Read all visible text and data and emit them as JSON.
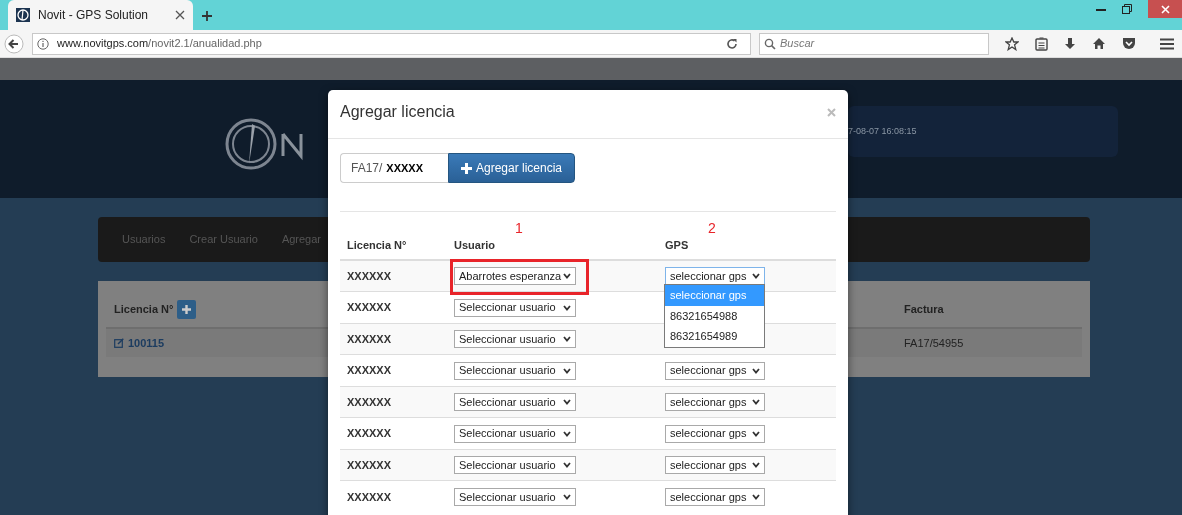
{
  "browser": {
    "tab_title": "Novit - GPS Solution",
    "url_host": "www.novitgps.com",
    "url_path": "/novit2.1/anualidad.php",
    "search_placeholder": "Buscar"
  },
  "background": {
    "datetime": "7-08-07 16:08:15",
    "nav_items": [
      "Usuarios",
      "Crear Usuario",
      "Agregar"
    ],
    "panel": {
      "columns": [
        "Licencia N°",
        "Factura"
      ],
      "rows": [
        [
          "100115",
          "FA17/54955"
        ]
      ]
    }
  },
  "modal": {
    "title": "Agregar licencia",
    "prefix": "FA17/",
    "code": "XXXXX",
    "add_button": "Agregar licencia",
    "columns": [
      {
        "label": "Licencia N°"
      },
      {
        "label": "Usuario",
        "annotation": "1"
      },
      {
        "label": "GPS",
        "annotation": "2"
      }
    ],
    "rows": [
      {
        "licence": "XXXXXX",
        "user": "Abarrotes esperanza",
        "highlighted": true,
        "gps": "seleccionar gps",
        "gps_open": true,
        "gps_options": [
          {
            "label": "seleccionar gps",
            "selected": true
          },
          {
            "label": "86321654988",
            "selected": false
          },
          {
            "label": "86321654989",
            "selected": false
          }
        ]
      },
      {
        "licence": "XXXXXX",
        "user": "Seleccionar usuario",
        "highlighted": false
      },
      {
        "licence": "XXXXXX",
        "user": "Seleccionar usuario",
        "highlighted": false
      },
      {
        "licence": "XXXXXX",
        "user": "Seleccionar usuario",
        "highlighted": false,
        "gps": "seleccionar gps",
        "gps_open": false
      },
      {
        "licence": "XXXXXX",
        "user": "Seleccionar usuario",
        "highlighted": false,
        "gps": "seleccionar gps",
        "gps_open": false
      },
      {
        "licence": "XXXXXX",
        "user": "Seleccionar usuario",
        "highlighted": false,
        "gps": "seleccionar gps",
        "gps_open": false
      },
      {
        "licence": "XXXXXX",
        "user": "Seleccionar usuario",
        "highlighted": false,
        "gps": "seleccionar gps",
        "gps_open": false
      },
      {
        "licence": "XXXXXX",
        "user": "Seleccionar usuario",
        "highlighted": false,
        "gps": "seleccionar gps",
        "gps_open": false
      }
    ]
  }
}
